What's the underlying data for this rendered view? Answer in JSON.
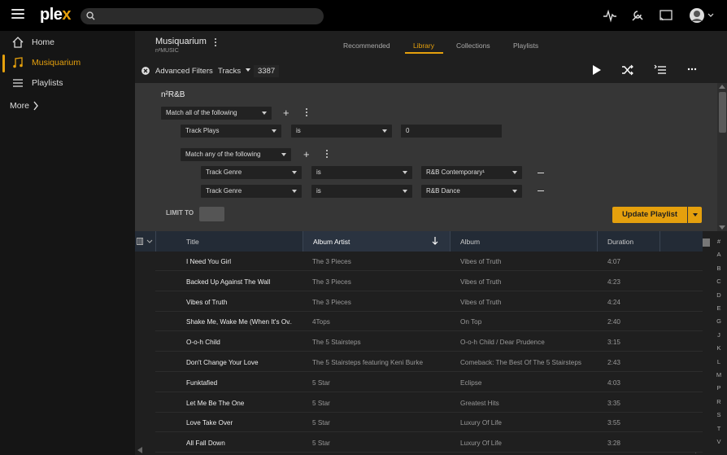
{
  "app": {
    "logo_main": "ple",
    "logo_x": "x"
  },
  "sidebar": {
    "items": [
      {
        "label": "Home",
        "icon": "home-icon"
      },
      {
        "label": "Musiquarium",
        "icon": "music-note-icon"
      },
      {
        "label": "Playlists",
        "icon": "list-icon"
      }
    ],
    "more_label": "More"
  },
  "library": {
    "title": "Musiquarium",
    "subtitle": "n²MUSIC",
    "tabs": [
      "Recommended",
      "Library",
      "Collections",
      "Playlists"
    ],
    "active_tab": "Library"
  },
  "filter_bar": {
    "label": "Advanced Filters",
    "type": "Tracks",
    "count": "3387"
  },
  "rule": {
    "title": "n²R&B",
    "match_all": "Match all of the following",
    "cond1": {
      "field": "Track Plays",
      "op": "is",
      "value": "0"
    },
    "match_any": "Match any of the following",
    "cond2": {
      "field": "Track Genre",
      "op": "is",
      "value": "R&B Contemporary¹"
    },
    "cond3": {
      "field": "Track Genre",
      "op": "is",
      "value": "R&B Dance"
    },
    "limit_label": "LIMIT TO",
    "update_label": "Update Playlist"
  },
  "table": {
    "headers": {
      "title": "Title",
      "artist": "Album Artist",
      "album": "Album",
      "duration": "Duration"
    },
    "rows": [
      {
        "title": "I Need You Girl",
        "artist": "The 3 Pieces",
        "album": "Vibes of Truth",
        "duration": "4:07"
      },
      {
        "title": "Backed Up Against The Wall",
        "artist": "The 3 Pieces",
        "album": "Vibes of Truth",
        "duration": "4:23"
      },
      {
        "title": "Vibes of Truth",
        "artist": "The 3 Pieces",
        "album": "Vibes of Truth",
        "duration": "4:24"
      },
      {
        "title": "Shake Me, Wake Me (When It's Ov...",
        "artist": "4Tops",
        "album": "On Top",
        "duration": "2:40"
      },
      {
        "title": "O-o-h Child",
        "artist": "The 5 Stairsteps",
        "album": "O-o-h Child / Dear Prudence",
        "duration": "3:15"
      },
      {
        "title": "Don't Change Your Love",
        "artist": "The 5 Stairsteps featuring Keni Burke",
        "album": "Comeback: The Best Of The 5 Stairsteps",
        "duration": "2:43"
      },
      {
        "title": "Funktafied",
        "artist": "5 Star",
        "album": "Eclipse",
        "duration": "4:03"
      },
      {
        "title": "Let Me Be The One",
        "artist": "5 Star",
        "album": "Greatest Hits",
        "duration": "3:35"
      },
      {
        "title": "Love Take Over",
        "artist": "5 Star",
        "album": "Luxury Of Life",
        "duration": "3:55"
      },
      {
        "title": "All Fall Down",
        "artist": "5 Star",
        "album": "Luxury Of Life",
        "duration": "3:28"
      }
    ]
  },
  "alphabet": [
    "#",
    "A",
    "B",
    "C",
    "D",
    "E",
    "G",
    "J",
    "K",
    "L",
    "M",
    "P",
    "R",
    "S",
    "T",
    "V"
  ],
  "colors": {
    "accent": "#e5a00d",
    "background": "#1f1f1f",
    "sidebar": "#151515"
  }
}
